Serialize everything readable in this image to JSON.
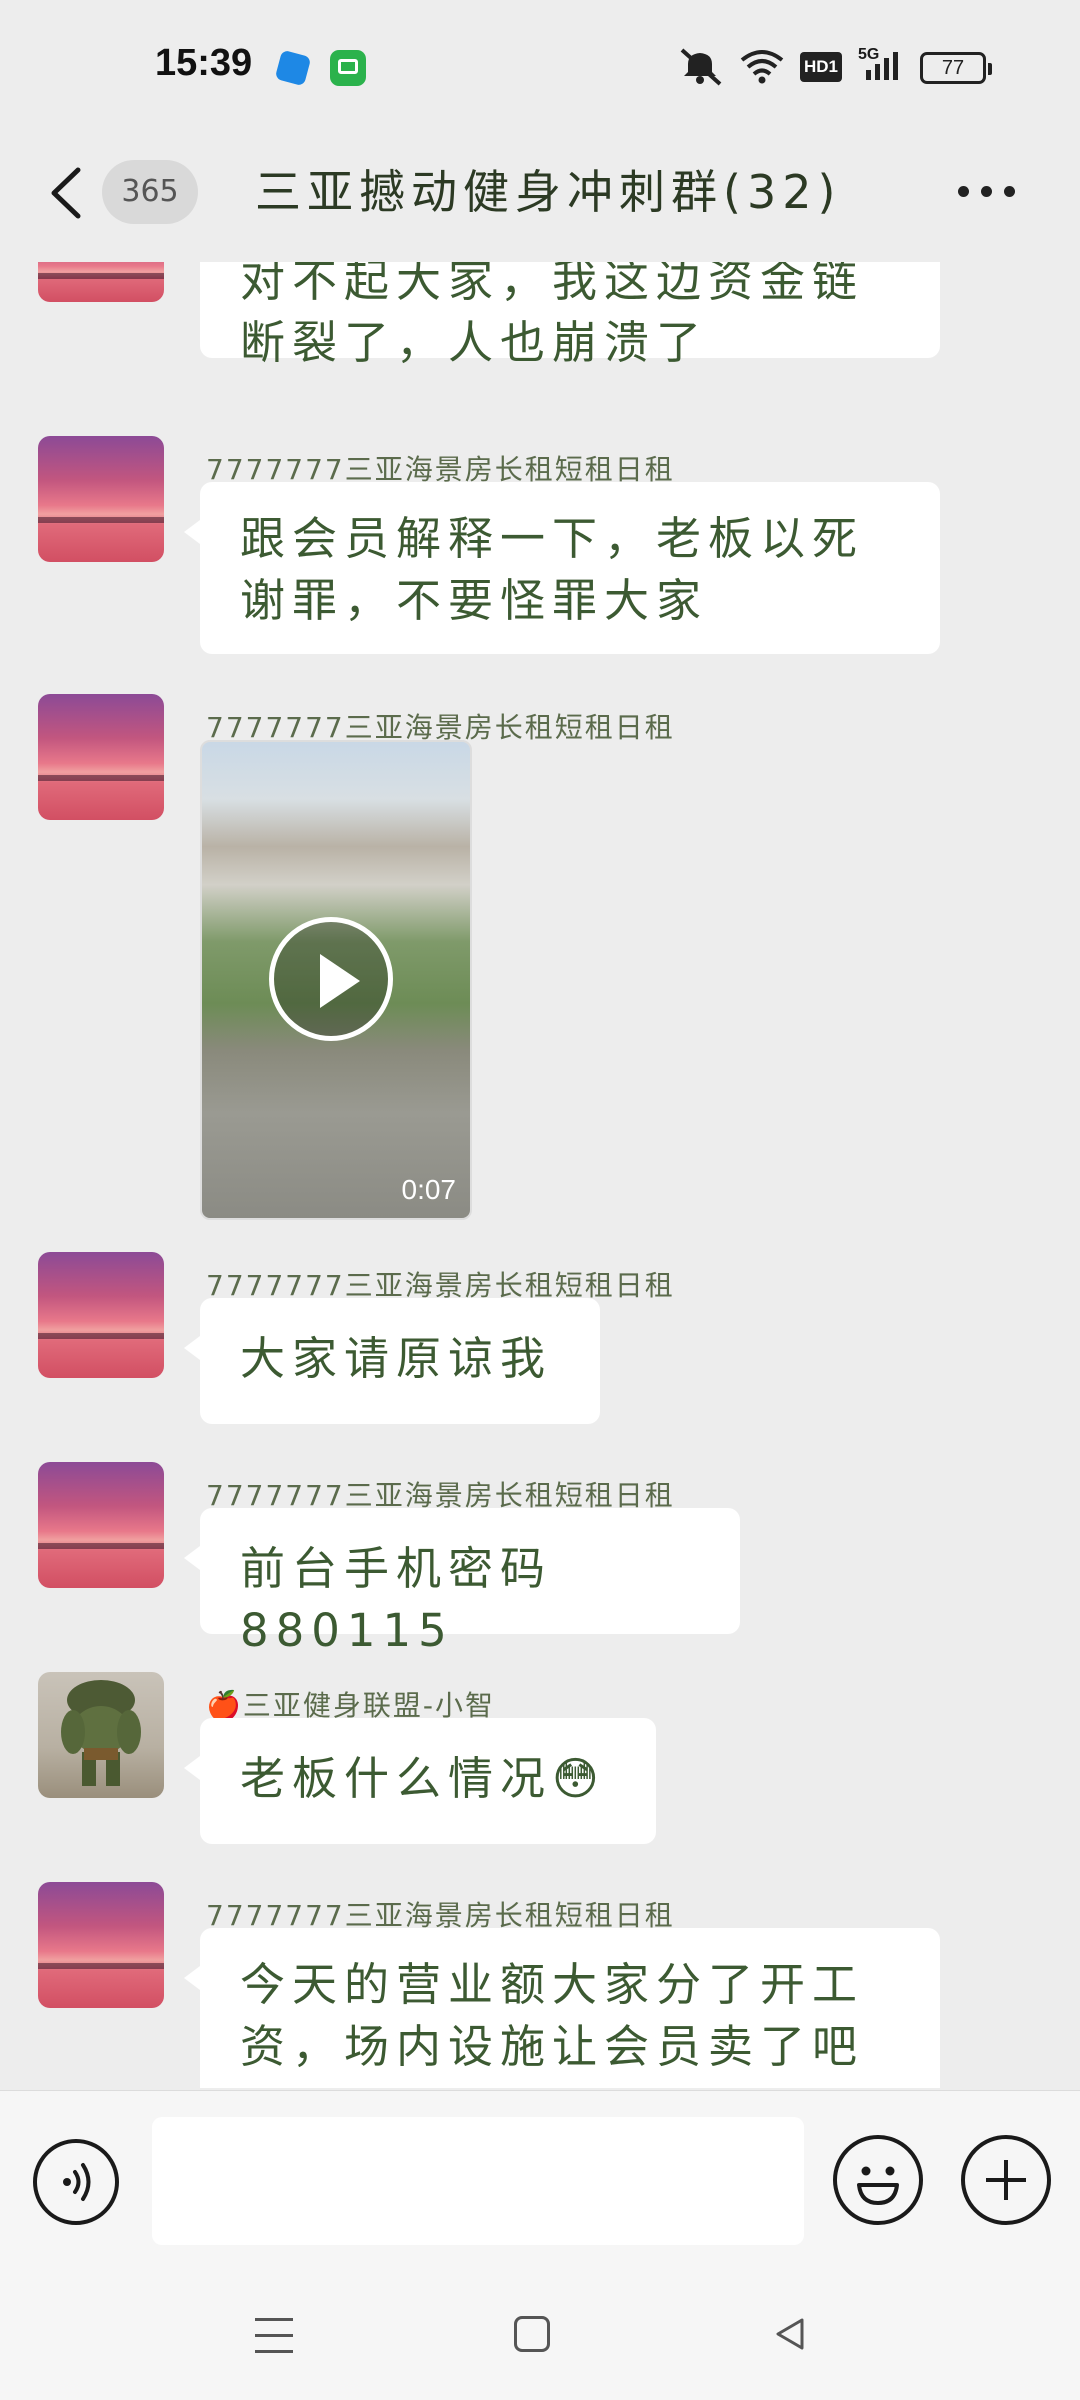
{
  "status_bar": {
    "time": "15:39",
    "network": "5G",
    "hd_badge": "HD1",
    "battery": "77",
    "icons": [
      "mute-icon",
      "wifi-icon",
      "hd-icon",
      "signal-icon",
      "battery-icon"
    ]
  },
  "header": {
    "back_icon": "chevron-left-icon",
    "unread_count": "365",
    "title": "三亚撼动健身冲刺群(32)",
    "more_icon": "more-icon"
  },
  "messages": [
    {
      "sender": "",
      "type": "text",
      "text": "对不起大家，我这边资金链断裂了，人也崩溃了"
    },
    {
      "sender": "7777777三亚海景房长租短租日租",
      "type": "text",
      "text": "跟会员解释一下，老板以死谢罪，不要怪罪大家"
    },
    {
      "sender": "7777777三亚海景房长租短租日租",
      "type": "video",
      "duration": "0:07"
    },
    {
      "sender": "7777777三亚海景房长租短租日租",
      "type": "text",
      "text": "大家请原谅我"
    },
    {
      "sender": "7777777三亚海景房长租短租日租",
      "type": "text",
      "text": "前台手机密码880115"
    },
    {
      "sender": "🍎三亚健身联盟-小智",
      "type": "text",
      "text": "老板什么情况😳"
    },
    {
      "sender": "7777777三亚海景房长租短租日租",
      "type": "text",
      "text": "今天的营业额大家分了开工资，场内设施让会员卖了吧"
    }
  ],
  "input_bar": {
    "voice_icon": "voice-icon",
    "placeholder": "",
    "emoji_icon": "emoji-icon",
    "plus_icon": "plus-icon"
  },
  "nav_bar": {
    "icons": [
      "menu-icon",
      "home-icon",
      "back-icon"
    ]
  }
}
